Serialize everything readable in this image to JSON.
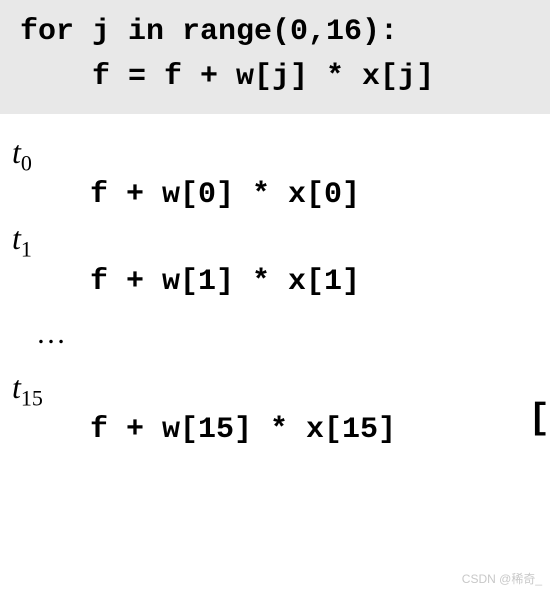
{
  "code": {
    "line1": "for j in range(0,16):",
    "line2": "    f = f + w[j] * x[j]"
  },
  "steps": {
    "t0": {
      "label_var": "t",
      "label_sub": "0",
      "expr": "f + w[0] * x[0]"
    },
    "t1": {
      "label_var": "t",
      "label_sub": "1",
      "expr": "f + w[1] * x[1]"
    },
    "ellipsis": "…",
    "t15": {
      "label_var": "t",
      "label_sub": "15",
      "expr": "f + w[15] * x[15]"
    }
  },
  "watermark": "CSDN @稀奇_"
}
